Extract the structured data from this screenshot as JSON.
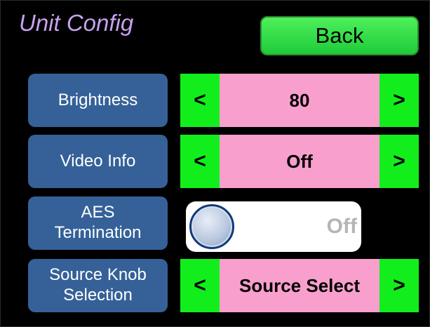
{
  "header": {
    "title": "Unit Config",
    "back_label": "Back"
  },
  "settings": [
    {
      "label": "Brightness",
      "type": "stepper",
      "value": "80",
      "prev_label": "<",
      "next_label": ">"
    },
    {
      "label": "Video Info",
      "type": "stepper",
      "value": "Off",
      "prev_label": "<",
      "next_label": ">"
    },
    {
      "label": "AES\nTermination",
      "type": "toggle",
      "value": "Off"
    },
    {
      "label": "Source Knob\nSelection",
      "type": "stepper",
      "value": "Source Select",
      "prev_label": "<",
      "next_label": ">"
    }
  ],
  "colors": {
    "background": "#000000",
    "title": "#c7a0ef",
    "back_button": "#2fdc45",
    "label_button": "#356198",
    "arrow_button": "#12ee1c",
    "value_field": "#f99fcd",
    "toggle_track": "#ffffff",
    "toggle_off_text": "#b5b5b5"
  },
  "icons": {
    "toggle_knob": "circle-knob-icon"
  }
}
